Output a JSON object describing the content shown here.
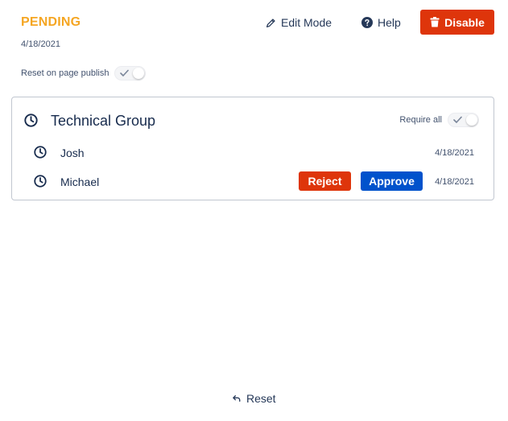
{
  "status": {
    "label": "PENDING",
    "date": "4/18/2021",
    "color": "#f5a623"
  },
  "toolbar": {
    "edit_label": "Edit Mode",
    "help_label": "Help",
    "disable_label": "Disable",
    "disable_color": "#de350b"
  },
  "settings": {
    "reset_on_publish_label": "Reset on page publish",
    "reset_on_publish_enabled": false
  },
  "group": {
    "name": "Technical Group",
    "require_all_label": "Require all",
    "require_all_enabled": false,
    "members": [
      {
        "name": "Josh",
        "date": "4/18/2021"
      },
      {
        "name": "Michael",
        "date": "4/18/2021",
        "reject_label": "Reject",
        "approve_label": "Approve"
      }
    ]
  },
  "colors": {
    "reject": "#de350b",
    "approve": "#0052cc"
  },
  "footer": {
    "reset_label": "Reset"
  }
}
